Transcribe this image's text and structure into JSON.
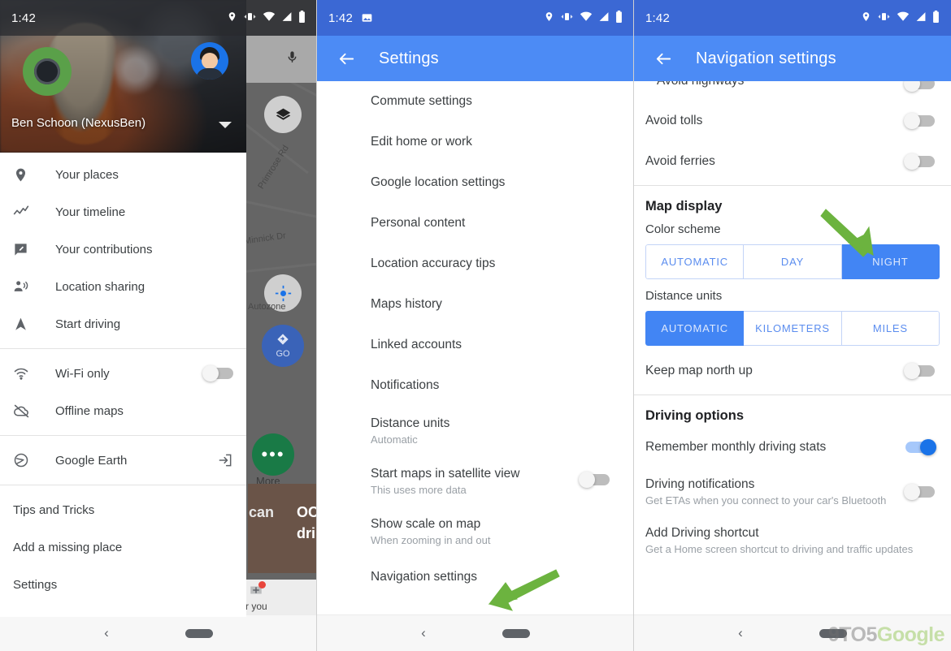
{
  "panel_drawer": {
    "status_bar": {
      "time": "1:42",
      "icons": [
        "location-pin",
        "vibrate",
        "wifi",
        "signal",
        "battery"
      ]
    },
    "header": {
      "account_name": "Ben Schoon (NexusBen)",
      "avatar": "profile-avatar",
      "expand_icon": "caret-down-icon"
    },
    "items": [
      {
        "label": "Your places",
        "icon": "place-pin-icon"
      },
      {
        "label": "Your timeline",
        "icon": "timeline-icon"
      },
      {
        "label": "Your contributions",
        "icon": "contributions-icon"
      },
      {
        "label": "Location sharing",
        "icon": "location-sharing-icon"
      },
      {
        "label": "Start driving",
        "icon": "navigation-arrow-icon"
      }
    ],
    "toggles": [
      {
        "label": "Wi-Fi only",
        "icon": "wifi-icon",
        "state": "off"
      },
      {
        "label": "Offline maps",
        "icon": "offline-cloud-icon"
      }
    ],
    "apps": [
      {
        "label": "Google Earth",
        "icon": "google-earth-icon",
        "trailing_icon": "open-external-icon"
      }
    ],
    "footer_items": [
      "Tips and Tricks",
      "Add a missing place",
      "Settings"
    ],
    "map": {
      "mic_icon": "microphone-icon",
      "layers_icon": "layers-icon",
      "my_location_icon": "my-location-icon",
      "go_label": "GO",
      "more_label": "More",
      "road_labels": [
        "Primrose Rd",
        "Minnick Dr",
        "Autozone"
      ],
      "card_snippets": [
        "can",
        "OC",
        "dri",
        "r you"
      ]
    }
  },
  "panel_settings": {
    "status_bar": {
      "time": "1:42",
      "icons": [
        "screenshot",
        "location-pin",
        "vibrate",
        "wifi",
        "signal",
        "battery"
      ]
    },
    "appbar": {
      "title": "Settings",
      "back_icon": "back-arrow-icon"
    },
    "items": [
      {
        "title": "Commute settings"
      },
      {
        "title": "Edit home or work"
      },
      {
        "title": "Google location settings"
      },
      {
        "title": "Personal content"
      },
      {
        "title": "Location accuracy tips"
      },
      {
        "title": "Maps history"
      },
      {
        "title": "Linked accounts"
      },
      {
        "title": "Notifications"
      },
      {
        "title": "Distance units",
        "subtitle": "Automatic"
      },
      {
        "title": "Start maps in satellite view",
        "subtitle": "This uses more data",
        "toggle": "off"
      },
      {
        "title": "Show scale on map",
        "subtitle": "When zooming in and out"
      },
      {
        "title": "Navigation settings"
      }
    ]
  },
  "panel_navigation": {
    "status_bar": {
      "time": "1:42",
      "icons": [
        "location-pin",
        "vibrate",
        "wifi",
        "signal",
        "battery"
      ]
    },
    "appbar": {
      "title": "Navigation settings",
      "back_icon": "back-arrow-icon"
    },
    "clipped_row": {
      "title": "Avoid highways",
      "toggle": "off"
    },
    "avoid_rows": [
      {
        "title": "Avoid tolls",
        "toggle": "off"
      },
      {
        "title": "Avoid ferries",
        "toggle": "off"
      }
    ],
    "map_display": {
      "heading": "Map display",
      "color_scheme": {
        "label": "Color scheme",
        "options": [
          "AUTOMATIC",
          "DAY",
          "NIGHT"
        ],
        "selected": "NIGHT"
      },
      "distance_units": {
        "label": "Distance units",
        "options": [
          "AUTOMATIC",
          "KILOMETERS",
          "MILES"
        ],
        "selected": "AUTOMATIC"
      },
      "keep_north_up": {
        "title": "Keep map north up",
        "toggle": "off"
      }
    },
    "driving_options": {
      "heading": "Driving options",
      "rows": [
        {
          "title": "Remember monthly driving stats",
          "toggle": "on"
        },
        {
          "title": "Driving notifications",
          "subtitle": "Get ETAs when you connect to your car's Bluetooth",
          "toggle": "off"
        },
        {
          "title": "Add Driving shortcut",
          "subtitle": "Get a Home screen shortcut to driving and traffic updates"
        }
      ]
    }
  },
  "annotations": {
    "arrow_color": "#6cb33f",
    "arrow_night": "points-to-night-button",
    "arrow_nav_settings": "points-to-navigation-settings"
  },
  "watermark": {
    "part1": "9TO5",
    "part2": "Google"
  },
  "nav_bar": {
    "back_icon": "back-chevron-icon",
    "home_pill": "home-pill-handle"
  },
  "colors": {
    "status_bar_blue": "#3b68d4",
    "app_bar_blue": "#4c8bf5",
    "accent_blue": "#4285f4",
    "toggle_on": "#1a73e8",
    "annotation_green": "#6cb33f"
  }
}
